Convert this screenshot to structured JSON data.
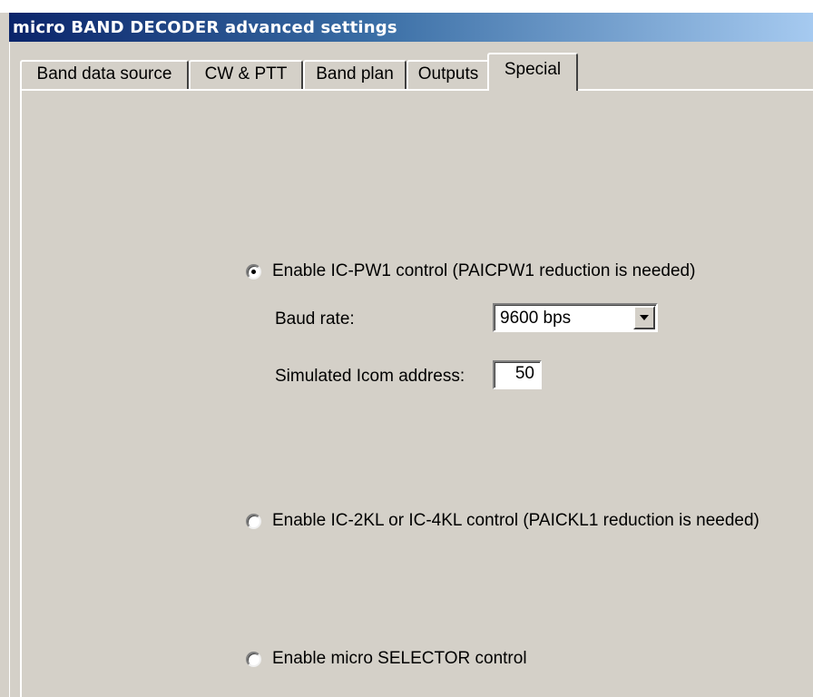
{
  "window": {
    "title": "micro BAND DECODER advanced settings"
  },
  "tabs": [
    {
      "label": "Band data source",
      "selected": false
    },
    {
      "label": "CW & PTT",
      "selected": false
    },
    {
      "label": "Band plan",
      "selected": false
    },
    {
      "label": "Outputs",
      "selected": false
    },
    {
      "label": "Special",
      "selected": true
    }
  ],
  "special": {
    "icpw1": {
      "label": "Enable IC-PW1 control (PAICPW1 reduction is needed)",
      "checked": true,
      "baud_label": "Baud rate:",
      "baud_value": "9600 bps",
      "address_label": "Simulated Icom address:",
      "address_value": "50"
    },
    "ic2kl": {
      "label": "Enable IC-2KL or IC-4KL control (PAICKL1 reduction is needed)",
      "checked": false
    },
    "selector": {
      "label": "Enable micro SELECTOR control",
      "checked": false
    }
  },
  "colors": {
    "face": "#d4d0c8",
    "title_start": "#0a246a",
    "title_end": "#a6caf0"
  },
  "icons": {
    "dropdown": "chevron-down-icon"
  }
}
